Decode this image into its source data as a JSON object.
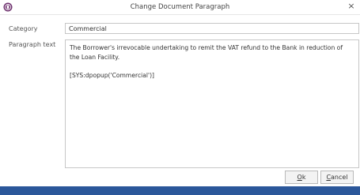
{
  "window": {
    "title": "Change Document Paragraph",
    "close_glyph": "×"
  },
  "form": {
    "category_label": "Category",
    "category_value": "Commercial",
    "paragraph_label": "Paragraph text",
    "paragraph_lines": [
      "The Borrower's irrevocable undertaking to remit the VAT refund to the Bank in reduction of",
      "the Loan Facility.",
      "",
      "[SYS:dpopup('Commercial')]"
    ]
  },
  "buttons": {
    "ok_mnemonic": "O",
    "ok_rest": "k",
    "cancel_mnemonic": "C",
    "cancel_rest": "ancel"
  },
  "colors": {
    "accent": "#2b579a",
    "icon": "#6b2c6b",
    "border": "#c7c7c7"
  },
  "icons": {
    "app": "app-logo-icon",
    "close": "close-icon"
  }
}
